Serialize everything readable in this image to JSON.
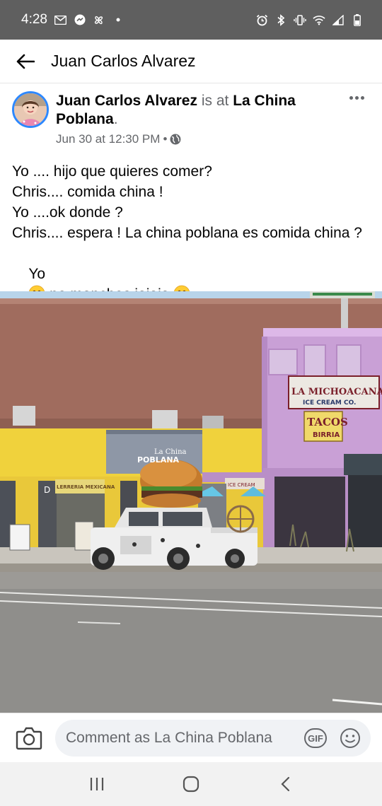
{
  "status_bar": {
    "time": "4:28",
    "left_icons": [
      "gmail-icon",
      "messenger-icon",
      "pinwheel-icon",
      "dot-icon"
    ],
    "right_icons": [
      "alarm-icon",
      "bluetooth-icon",
      "vibrate-icon",
      "wifi-icon",
      "signal-icon",
      "battery-icon"
    ]
  },
  "header": {
    "title": "Juan Carlos Alvarez",
    "back_icon": "arrow-left-icon"
  },
  "post": {
    "author": "Juan Carlos Alvarez",
    "connector": "is at",
    "place": "La China Poblana",
    "place_suffix": ".",
    "timestamp": "Jun 30 at 12:30 PM",
    "separator": "•",
    "privacy_icon": "globe-icon",
    "more_icon": "more-dots-icon",
    "lines": [
      "Yo .... hijo que quieres comer?",
      "Chris.... comida china !",
      "Yo ....ok donde ?",
      "Chris.... espera ! La china poblana es comida china ?"
    ],
    "last_line": {
      "prefix": "Yo",
      "middle": " no manches jajaja ",
      "emoji": "grinning-face-emoji"
    },
    "photo_signs": {
      "sign_left": "La China",
      "sign_left_2": "POBLANA",
      "sign_right": "LA MICHOACANA",
      "sign_right_2": "ICE CREAM CO.",
      "sign_tacos": "TACOS",
      "sign_birria": "BIRRIA",
      "sign_store": "LERRERIA MEXICANA",
      "sign_ice": "ICE CREAM",
      "sign_d": "D"
    }
  },
  "comment_bar": {
    "placeholder": "Comment as La China Poblana",
    "gif_label": "GIF",
    "camera_icon": "camera-icon",
    "emoji_icon": "smiley-icon"
  },
  "nav_bar": {
    "icons": [
      "recents-icon",
      "home-icon",
      "back-icon"
    ]
  }
}
